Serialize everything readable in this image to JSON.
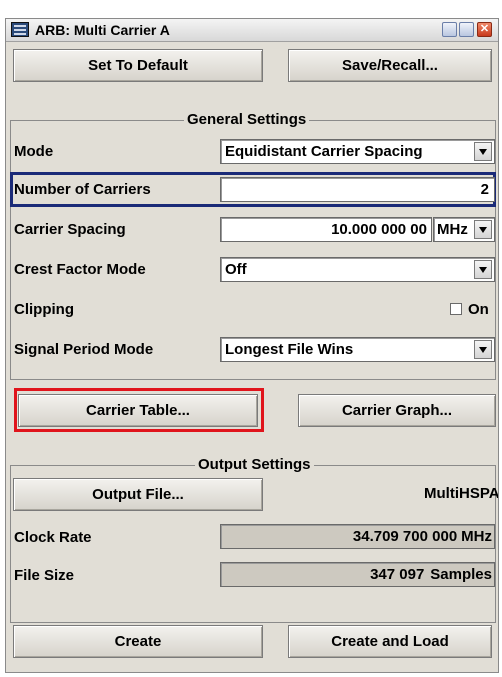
{
  "window": {
    "title": "ARB: Multi Carrier A"
  },
  "buttons": {
    "set_default": "Set To Default",
    "save_recall": "Save/Recall...",
    "carrier_table": "Carrier Table...",
    "carrier_graph": "Carrier Graph...",
    "output_file": "Output File...",
    "create": "Create",
    "create_and_load": "Create and Load"
  },
  "general": {
    "title": "General Settings",
    "mode": {
      "label": "Mode",
      "value": "Equidistant Carrier Spacing"
    },
    "num_carriers": {
      "label": "Number of Carriers",
      "value": "2"
    },
    "carrier_spacing": {
      "label": "Carrier Spacing",
      "value": "10.000 000 00",
      "unit": "MHz"
    },
    "crest_factor": {
      "label": "Crest Factor Mode",
      "value": "Off"
    },
    "clipping": {
      "label": "Clipping",
      "checkbox_label": "On",
      "checked": false
    },
    "signal_period": {
      "label": "Signal Period Mode",
      "value": "Longest File Wins"
    }
  },
  "output": {
    "title": "Output Settings",
    "file_name": "MultiHSPA",
    "clock_rate": {
      "label": "Clock Rate",
      "value": "34.709 700 000",
      "unit": "MHz"
    },
    "file_size": {
      "label": "File Size",
      "value": "347 097",
      "unit": "Samples"
    }
  },
  "colors": {
    "highlight_blue": "#1a2a78",
    "highlight_red": "#e0141c",
    "panel": "#e1ded6"
  }
}
